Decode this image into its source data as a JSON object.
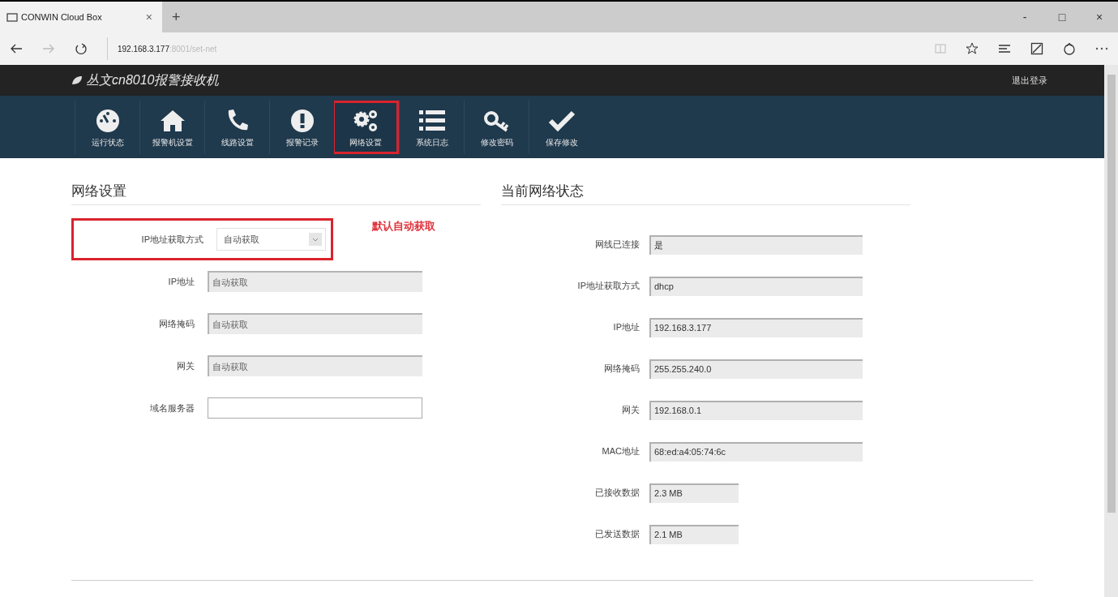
{
  "browser": {
    "tab_title": "CONWIN Cloud Box",
    "tab_close": "×",
    "new_tab": "+",
    "url_host": "192.168.3.177",
    "url_rest": ":8001/set-net",
    "window_buttons": [
      "-",
      "□",
      "×"
    ]
  },
  "header": {
    "title": "丛文cn8010报警接收机",
    "logout": "退出登录"
  },
  "nav": [
    {
      "kind": "gauge",
      "label": "运行状态",
      "selected": false
    },
    {
      "kind": "home",
      "label": "报警机设置",
      "selected": false
    },
    {
      "kind": "phone",
      "label": "线路设置",
      "selected": false
    },
    {
      "kind": "alert",
      "label": "报警记录",
      "selected": false
    },
    {
      "kind": "gears",
      "label": "网络设置",
      "selected": true
    },
    {
      "kind": "list",
      "label": "系统日志",
      "selected": false
    },
    {
      "kind": "key",
      "label": "修改密码",
      "selected": false
    },
    {
      "kind": "check",
      "label": "保存修改",
      "selected": false
    }
  ],
  "network_settings": {
    "title": "网络设置",
    "note": "默认自动获取",
    "fields": [
      {
        "kind": "select",
        "label": "IP地址获取方式",
        "value": "自动获取"
      },
      {
        "kind": "disabled",
        "label": "IP地址",
        "value": "自动获取"
      },
      {
        "kind": "disabled",
        "label": "网络掩码",
        "value": "自动获取"
      },
      {
        "kind": "disabled",
        "label": "网关",
        "value": "自动获取"
      },
      {
        "kind": "text",
        "label": "域名服务器"
      }
    ]
  },
  "network_status": {
    "title": "当前网络状态",
    "fields": [
      {
        "kind": "wide",
        "label": "网线已连接",
        "value": "是"
      },
      {
        "kind": "wide",
        "label": "IP地址获取方式",
        "value": "dhcp"
      },
      {
        "kind": "wide",
        "label": "IP地址",
        "value": "192.168.3.177"
      },
      {
        "kind": "wide",
        "label": "网络掩码",
        "value": "255.255.240.0"
      },
      {
        "kind": "wide",
        "label": "网关",
        "value": "192.168.0.1"
      },
      {
        "kind": "wide",
        "label": "MAC地址",
        "value": "68:ed:a4:05:74:6c"
      },
      {
        "kind": "short",
        "label": "已接收数据",
        "value": "2.3 MB"
      },
      {
        "kind": "short",
        "label": "已发送数据",
        "value": "2.1 MB"
      }
    ]
  }
}
